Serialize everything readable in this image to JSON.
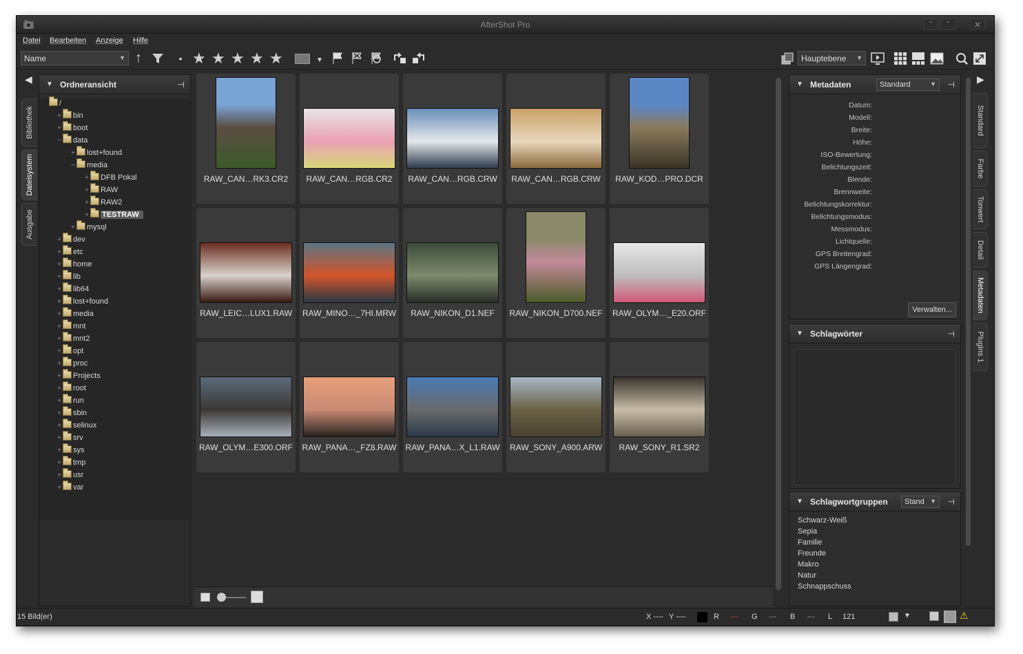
{
  "window": {
    "title": "AfterShot Pro"
  },
  "menu": [
    "Datei",
    "Bearbeiten",
    "Anzeige",
    "Hilfe"
  ],
  "toolbar": {
    "sort_value": "Name",
    "layer_value": "Hauptebene"
  },
  "left_tabs": [
    "Bibliothek",
    "Dateisystem",
    "Ausgabe"
  ],
  "folder_panel": {
    "title": "Ordneransicht",
    "tree": [
      {
        "label": "/",
        "depth": 0
      },
      {
        "label": "bin",
        "depth": 1
      },
      {
        "label": "boot",
        "depth": 1
      },
      {
        "label": "data",
        "depth": 1
      },
      {
        "label": "lost+found",
        "depth": 2
      },
      {
        "label": "media",
        "depth": 2
      },
      {
        "label": "DFB Pokal",
        "depth": 3
      },
      {
        "label": "RAW",
        "depth": 3
      },
      {
        "label": "RAW2",
        "depth": 3
      },
      {
        "label": "TESTRAW",
        "depth": 3,
        "selected": true
      },
      {
        "label": "mysql",
        "depth": 2
      },
      {
        "label": "dev",
        "depth": 1
      },
      {
        "label": "etc",
        "depth": 1
      },
      {
        "label": "home",
        "depth": 1
      },
      {
        "label": "lib",
        "depth": 1
      },
      {
        "label": "lib64",
        "depth": 1
      },
      {
        "label": "lost+found",
        "depth": 1
      },
      {
        "label": "media",
        "depth": 1
      },
      {
        "label": "mnt",
        "depth": 1
      },
      {
        "label": "mnt2",
        "depth": 1
      },
      {
        "label": "opt",
        "depth": 1
      },
      {
        "label": "proc",
        "depth": 1
      },
      {
        "label": "Projects",
        "depth": 1
      },
      {
        "label": "root",
        "depth": 1
      },
      {
        "label": "run",
        "depth": 1
      },
      {
        "label": "sbin",
        "depth": 1
      },
      {
        "label": "selinux",
        "depth": 1
      },
      {
        "label": "srv",
        "depth": 1
      },
      {
        "label": "sys",
        "depth": 1
      },
      {
        "label": "tmp",
        "depth": 1
      },
      {
        "label": "usr",
        "depth": 1
      },
      {
        "label": "var",
        "depth": 1
      }
    ]
  },
  "thumbnails": [
    {
      "name": "RAW_CAN…RK3.CR2",
      "orient": "portrait",
      "colors": [
        "#7aa3d6",
        "#5a4d42",
        "#3d5a2a"
      ]
    },
    {
      "name": "RAW_CAN…RGB.CR2",
      "orient": "landscape",
      "colors": [
        "#e8e4e6",
        "#e9a1b4",
        "#d9d67a"
      ]
    },
    {
      "name": "RAW_CAN…RGB.CRW",
      "orient": "landscape",
      "colors": [
        "#6a8fb8",
        "#e5e8ea",
        "#2f3c4d"
      ]
    },
    {
      "name": "RAW_CAN…RGB.CRW",
      "orient": "landscape",
      "colors": [
        "#c9a167",
        "#e8d7bd",
        "#8a6a3c"
      ]
    },
    {
      "name": "RAW_KOD…PRO.DCR",
      "orient": "portrait",
      "colors": [
        "#5b86c4",
        "#8a7a5c",
        "#3a3326"
      ]
    },
    {
      "name": "RAW_LEIC…LUX1.RAW",
      "orient": "landscape",
      "colors": [
        "#6a2e20",
        "#d8d2cc",
        "#3a1a12"
      ]
    },
    {
      "name": "RAW_MINO…_7HI.MRW",
      "orient": "landscape",
      "colors": [
        "#5c7584",
        "#d2542a",
        "#2c3a44"
      ]
    },
    {
      "name": "RAW_NIKON_D1.NEF",
      "orient": "landscape",
      "colors": [
        "#3c4c3a",
        "#7d8a6e",
        "#2a2f2a"
      ]
    },
    {
      "name": "RAW_NIKON_D700.NEF",
      "orient": "portrait",
      "colors": [
        "#8a8a6a",
        "#c28a9a",
        "#4c5a2a"
      ]
    },
    {
      "name": "RAW_OLYM…_E20.ORF",
      "orient": "landscape",
      "colors": [
        "#e6e6e6",
        "#bdbdbd",
        "#d25a7a"
      ]
    },
    {
      "name": "RAW_OLYM…E300.ORF",
      "orient": "landscape",
      "colors": [
        "#5a6a7a",
        "#3c3834",
        "#a8b0ba"
      ]
    },
    {
      "name": "RAW_PANA…_FZ8.RAW",
      "orient": "landscape",
      "colors": [
        "#e8a07a",
        "#c88a74",
        "#2a2420"
      ]
    },
    {
      "name": "RAW_PANA…X_L1.RAW",
      "orient": "landscape",
      "colors": [
        "#4a7ab4",
        "#6a6a6a",
        "#2a3a4a"
      ]
    },
    {
      "name": "RAW_SONY_A900.ARW",
      "orient": "landscape",
      "colors": [
        "#a8b8c6",
        "#6a6044",
        "#4a4232"
      ]
    },
    {
      "name": "RAW_SONY_R1.SR2",
      "orient": "landscape",
      "colors": [
        "#3a342c",
        "#c8bca8",
        "#6a6050"
      ]
    }
  ],
  "metadata_panel": {
    "title": "Metadaten",
    "preset": "Standard",
    "fields": [
      "Datum:",
      "Modell:",
      "Breite:",
      "Höhe:",
      "ISO-Bewertung:",
      "Belichtungszeit:",
      "Blende:",
      "Brennweite:",
      "Belichtungskorrektur:",
      "Belichtungsmodus:",
      "Messmodus:",
      "Lichtquelle:",
      "GPS Breitengrad:",
      "GPS Längengrad:"
    ],
    "manage_button": "Verwalten..."
  },
  "keywords_panel": {
    "title": "Schlagwörter"
  },
  "keyword_groups_panel": {
    "title": "Schlagwortgruppen",
    "preset": "Stand",
    "items": [
      "Schwarz-Weiß",
      "Sepia",
      "Familie",
      "Freunde",
      "Makro",
      "Natur",
      "Schnappschuss"
    ]
  },
  "right_tabs": [
    "Standard",
    "Farbe",
    "Tonwert",
    "Detail",
    "Metadaten",
    "Plugins 1"
  ],
  "status": {
    "count": "15 Bild(er)",
    "x": "X ----",
    "y": "Y ----",
    "r_label": "R",
    "r_value": "---",
    "g_label": "G",
    "g_value": "---",
    "b_label": "B",
    "b_value": "---",
    "l_label": "L",
    "l_value": "121"
  }
}
